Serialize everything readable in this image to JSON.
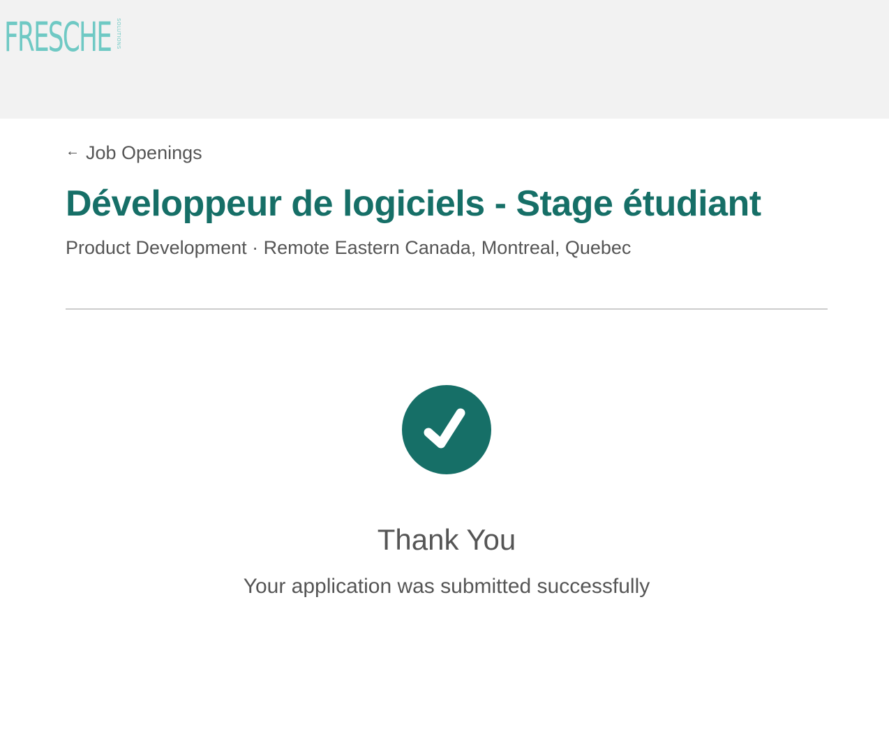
{
  "header": {
    "logo": {
      "wordmark": "FRESCHE",
      "subtext": "SOLUTIONS",
      "color": "#6fc9c4"
    },
    "background_color": "#f2f2f2"
  },
  "nav": {
    "back_link_label": "Job Openings",
    "back_icon": "arrow-left-icon"
  },
  "job": {
    "title": "Développeur de logiciels - Stage étudiant",
    "meta": "Product Development · Remote Eastern Canada, Montreal, Quebec",
    "title_color": "#166f67"
  },
  "confirmation": {
    "icon": "checkmark-circle-icon",
    "icon_color": "#166f67",
    "heading": "Thank You",
    "message": "Your application was submitted successfully"
  }
}
